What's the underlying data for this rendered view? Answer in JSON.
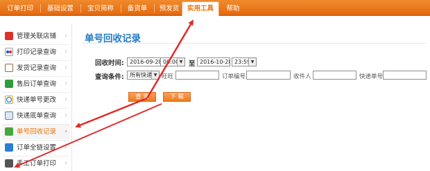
{
  "topnav": {
    "tabs": [
      "订单打印",
      "基础设置",
      "宝贝简称",
      "备货单",
      "预发货",
      "实用工具",
      "帮助"
    ],
    "active": "实用工具"
  },
  "sidebar": {
    "items": [
      {
        "label": "管理关联店铺",
        "icon": "shop-link-icon",
        "color": "#d9332b"
      },
      {
        "label": "打印记录查询",
        "icon": "print-record-icon",
        "color": "#4a6fc8"
      },
      {
        "label": "发货记录查询",
        "icon": "shipping-record-icon",
        "color": "#9a6a3a"
      },
      {
        "label": "售后订单查询",
        "icon": "after-sale-icon",
        "color": "#2f9e3a"
      },
      {
        "label": "快递单号更改",
        "icon": "tracking-edit-icon",
        "color": "#d9a21e"
      },
      {
        "label": "快递底单查询",
        "icon": "waybill-query-icon",
        "color": "#5c7fa8"
      },
      {
        "label": "单号回收记录",
        "icon": "recycle-icon",
        "color": "#48a73c"
      },
      {
        "label": "订单全链设置",
        "icon": "chain-settings-icon",
        "color": "#2b7fd0"
      },
      {
        "label": "手工订单打印",
        "icon": "manual-print-icon",
        "color": "#555555"
      }
    ],
    "active_index": 6
  },
  "main": {
    "title": "单号回收记录",
    "recycle_time_label": "回收时间:",
    "start_date": "2016-09-28",
    "start_time": "00:00",
    "to_label": "至",
    "end_date": "2016-10-28",
    "end_time": "23:59",
    "query_label": "查询条件:",
    "courier_select": "所有快递",
    "wangwang_label": "旺旺",
    "order_no_label": "订单编号",
    "recipient_label": "收件人",
    "tracking_no_label": "快递单号",
    "query_button": "查 询",
    "download_button": "下 载"
  },
  "colors": {
    "nav_orange": "#e8720e",
    "title_blue": "#1f7bc8",
    "annotation_red": "#e02a2a"
  }
}
